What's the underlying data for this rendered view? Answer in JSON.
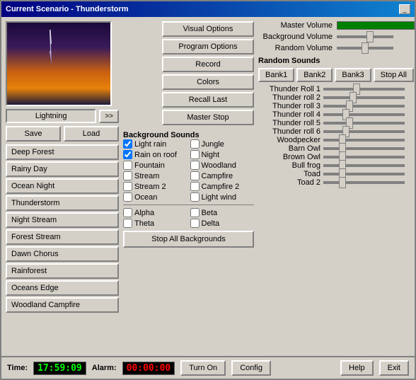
{
  "titleBar": {
    "title": "Current Scenario - Thunderstorm",
    "minimizeBtn": "_"
  },
  "preview": {
    "label": "Lightning",
    "arrowBtn": ">>"
  },
  "leftPanel": {
    "saveLabel": "Save",
    "loadLabel": "Load",
    "presets": [
      "Deep Forest",
      "Rainy Day",
      "Ocean Night",
      "Thunderstorm",
      "Night Stream",
      "Forest Stream",
      "Dawn Chorus",
      "Rainforest",
      "Oceans Edge",
      "Woodland Campfire"
    ]
  },
  "middlePanel": {
    "topButtons": [
      "Visual Options",
      "Program Options",
      "Record",
      "Colors",
      "Recall Last",
      "Master Stop"
    ],
    "bgSoundsLabel": "Background Sounds",
    "checkboxes": [
      {
        "label": "Light rain",
        "checked": true
      },
      {
        "label": "Jungle",
        "checked": false
      },
      {
        "label": "Rain on roof",
        "checked": true
      },
      {
        "label": "Night",
        "checked": false
      },
      {
        "label": "Fountain",
        "checked": false
      },
      {
        "label": "Woodland",
        "checked": false
      },
      {
        "label": "Stream",
        "checked": false
      },
      {
        "label": "Campfire",
        "checked": false
      },
      {
        "label": "Stream 2",
        "checked": false
      },
      {
        "label": "Campfire 2",
        "checked": false
      },
      {
        "label": "Ocean",
        "checked": false
      },
      {
        "label": "Light wind",
        "checked": false
      }
    ],
    "brainwaves": [
      {
        "label": "Alpha",
        "checked": false
      },
      {
        "label": "Beta",
        "checked": false
      },
      {
        "label": "Theta",
        "checked": false
      },
      {
        "label": "Delta",
        "checked": false
      }
    ],
    "stopAllLabel": "Stop All Backgrounds"
  },
  "rightPanel": {
    "masterVolumeLabel": "Master Volume",
    "bgVolumeLabel": "Background Volume",
    "randVolumeLabel": "Random Volume",
    "randomSoundsLabel": "Random Sounds",
    "banks": [
      "Bank1",
      "Bank2",
      "Bank3",
      "Stop All"
    ],
    "sounds": [
      {
        "label": "Thunder Roll 1",
        "value": 40
      },
      {
        "label": "Thunder roll 2",
        "value": 35
      },
      {
        "label": "Thunder roll 3",
        "value": 30
      },
      {
        "label": "Thunder roll 4",
        "value": 25
      },
      {
        "label": "Thunder roll 5",
        "value": 30
      },
      {
        "label": "Thunder roll 6",
        "value": 25
      },
      {
        "label": "Woodpecker",
        "value": 20
      },
      {
        "label": "Barn Owl",
        "value": 20
      },
      {
        "label": "Brown Owl",
        "value": 20
      },
      {
        "label": "Bull frog",
        "value": 20
      },
      {
        "label": "Toad",
        "value": 20
      },
      {
        "label": "Toad 2",
        "value": 20
      }
    ]
  },
  "bottomBar": {
    "timeLabel": "Time:",
    "timeValue": "17:59:09",
    "alarmLabel": "Alarm:",
    "alarmValue": "00:00:00",
    "turnOnLabel": "Turn On",
    "configLabel": "Config",
    "helpLabel": "Help",
    "exitLabel": "Exit"
  }
}
